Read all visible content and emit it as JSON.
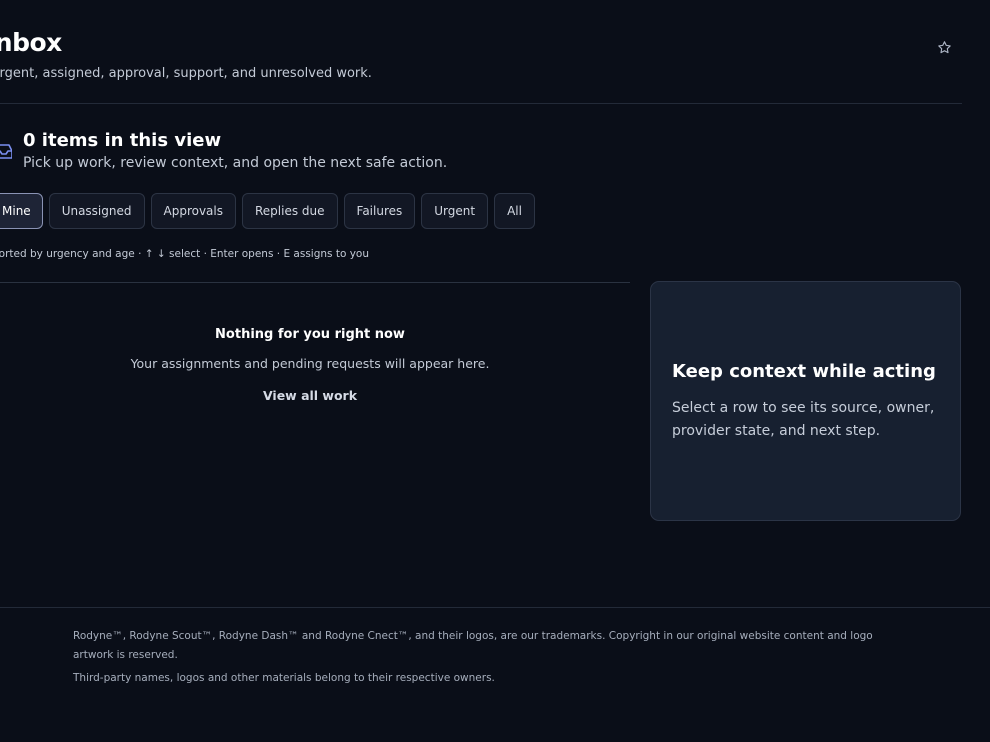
{
  "header": {
    "title": "Inbox",
    "subtitle": "Urgent, assigned, approval, support, and unresolved work.",
    "star_icon": "star-outline-icon"
  },
  "view": {
    "icon": "inbox-tray-icon",
    "count_label": "0 items in this view",
    "description": "Pick up work, review context, and open the next safe action."
  },
  "filters": [
    {
      "label": "Mine",
      "active": true
    },
    {
      "label": "Unassigned",
      "active": false
    },
    {
      "label": "Approvals",
      "active": false
    },
    {
      "label": "Replies due",
      "active": false
    },
    {
      "label": "Failures",
      "active": false
    },
    {
      "label": "Urgent",
      "active": false
    },
    {
      "label": "All",
      "active": false
    }
  ],
  "sort_hint": "Sorted by urgency and age · ↑ ↓ select · Enter opens · E assigns to you",
  "empty_state": {
    "title": "Nothing for you right now",
    "description": "Your assignments and pending requests will appear here.",
    "link": "View all work"
  },
  "context_panel": {
    "title": "Keep context while acting",
    "description": "Select a row to see its source, owner, provider state, and next step."
  },
  "footer": {
    "trademark": "Rodyne™, Rodyne Scout™, Rodyne Dash™ and Rodyne Cnect™, and their logos, are our trademarks. Copyright in our original website content and logo artwork is reserved.",
    "third_party": "Third-party names, logos and other materials belong to their respective owners."
  },
  "colors": {
    "background": "#0a0e18",
    "panel": "#172030",
    "active_chip_border": "#8a93b4",
    "view_icon": "#7b8ff0"
  }
}
